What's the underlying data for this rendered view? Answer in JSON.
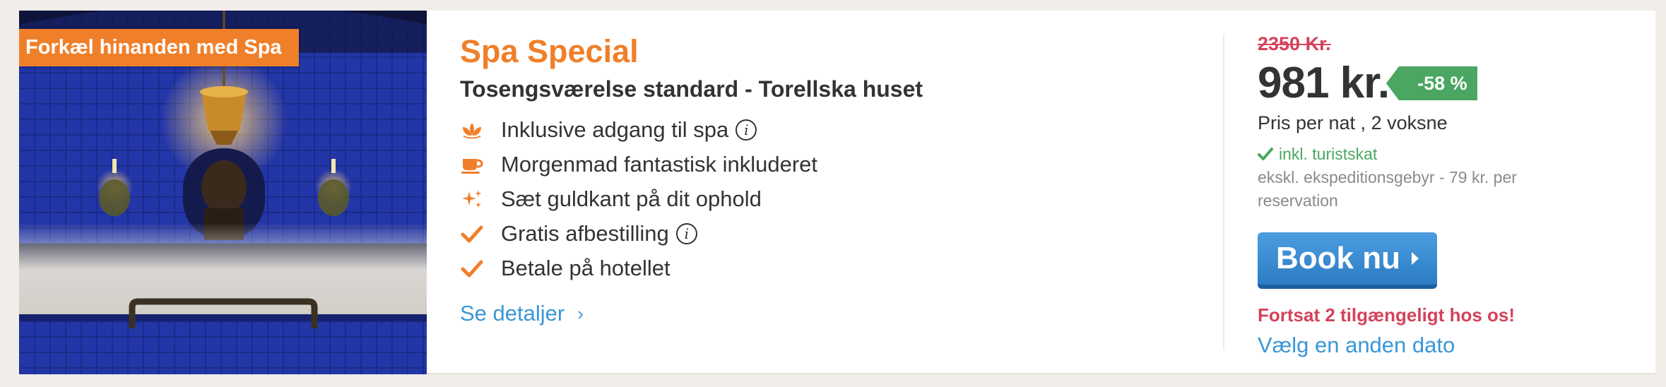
{
  "card": {
    "promo_badge": "Forkæl hinanden med Spa",
    "photo_icon": "spa-pool-photo",
    "offer_title": "Spa Special",
    "room_title": "Tosengsværelse standard - Torellska huset",
    "features": [
      {
        "icon": "lotus-icon",
        "text": "Inklusive adgang til spa",
        "info": "i"
      },
      {
        "icon": "coffee-cup-icon",
        "text": "Morgenmad fantastisk inkluderet",
        "info": ""
      },
      {
        "icon": "sparkles-icon",
        "text": "Sæt guldkant på dit ophold",
        "info": ""
      },
      {
        "icon": "checkmark-icon",
        "text": "Gratis afbestilling",
        "info": "i"
      },
      {
        "icon": "checkmark-icon",
        "text": "Betale på hotellet",
        "info": ""
      }
    ],
    "details_link": "Se detaljer",
    "details_chevron": "›"
  },
  "pricing": {
    "old_price": "2350 Kr.",
    "current_price": "981 kr.",
    "discount": "-58 %",
    "caption": "Pris per nat , 2 voksne",
    "tax_note": "inkl. turistskat",
    "fee_note": "ekskl. ekspeditionsgebyr - 79 kr. per reservation",
    "book_label": "Book nu",
    "availability": "Fortsat 2 tilgængeligt hos os!",
    "alt_date": "Vælg en anden dato"
  },
  "colors": {
    "accent_orange": "#f07f2a",
    "price_red": "#d3435a",
    "discount_green": "#4aa660",
    "link_blue": "#3a97d6",
    "button_blue": "#2c7bc4"
  }
}
